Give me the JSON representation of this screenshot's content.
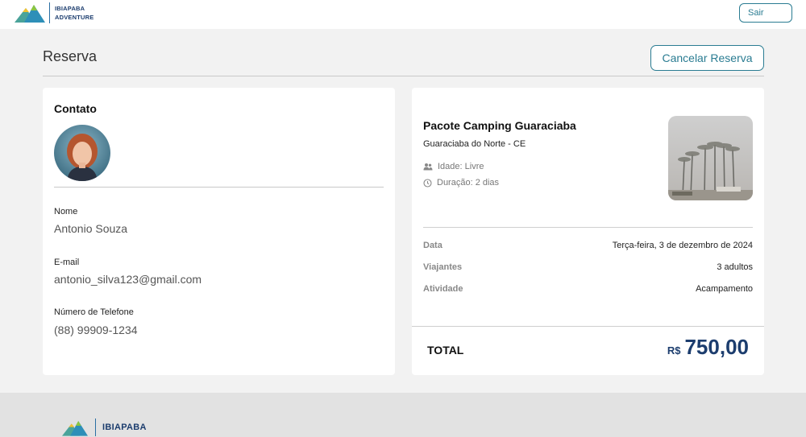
{
  "header": {
    "logo": {
      "line1": "IBIAPABA",
      "line2": "ADVENTURE"
    },
    "logout_label": "Sair"
  },
  "page": {
    "title": "Reserva",
    "cancel_label": "Cancelar Reserva"
  },
  "contact": {
    "title": "Contato",
    "fields": [
      {
        "label": "Nome",
        "value": "Antonio Souza"
      },
      {
        "label": "E-mail",
        "value": "antonio_silva123@gmail.com"
      },
      {
        "label": "Número de Telefone",
        "value": "(88) 99909-1234"
      }
    ]
  },
  "package": {
    "title": "Pacote Camping Guaraciaba",
    "location": "Guaraciaba do Norte - CE",
    "age": "Idade: Livre",
    "duration": "Duração: 2 dias",
    "details": [
      {
        "label": "Data",
        "value": "Terça-feira, 3 de dezembro de 2024"
      },
      {
        "label": "Viajantes",
        "value": "3 adultos"
      },
      {
        "label": "Atividade",
        "value": "Acampamento"
      }
    ],
    "total_label": "TOTAL",
    "total_currency": "R$",
    "total_amount": "750,00"
  },
  "footer": {
    "brand": "IBIAPABA"
  },
  "colors": {
    "accent": "#2a7c92",
    "brand_navy": "#1c3d6e",
    "background": "#f2f2f2",
    "footer_bg": "#e2e2e2"
  },
  "icons": {
    "age": "people-icon",
    "duration": "clock-icon",
    "logo": "mountain-logo-icon"
  }
}
